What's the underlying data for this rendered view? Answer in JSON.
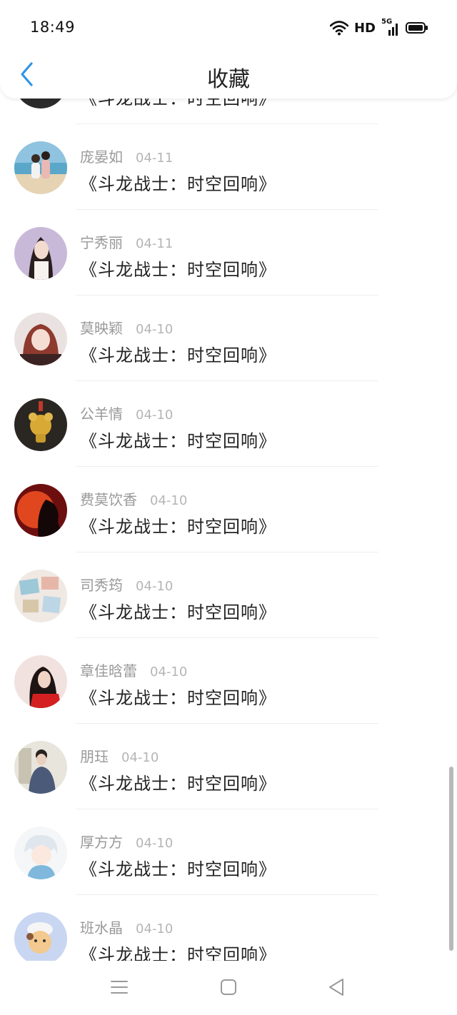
{
  "status_bar": {
    "time": "18:49",
    "network": "HD",
    "signal_label": "5G"
  },
  "header": {
    "title": "收藏",
    "back_icon": "chevron-left-icon",
    "accent": "#2f95e6"
  },
  "items": [
    {
      "name": "",
      "date": "",
      "title": "《斗龙战士：时空回响》",
      "avatar": "dark-avatar"
    },
    {
      "name": "庞晏如",
      "date": "04-11",
      "title": "《斗龙战士：时空回响》",
      "avatar": "beach-couple-photo"
    },
    {
      "name": "宁秀丽",
      "date": "04-11",
      "title": "《斗龙战士：时空回响》",
      "avatar": "woman-portrait"
    },
    {
      "name": "莫映颖",
      "date": "04-10",
      "title": "《斗龙战士：时空回响》",
      "avatar": "girl-portrait"
    },
    {
      "name": "公羊情",
      "date": "04-10",
      "title": "《斗龙战士：时空回响》",
      "avatar": "gold-mouse-pendant"
    },
    {
      "name": "费莫饮香",
      "date": "04-10",
      "title": "《斗龙战士：时空回响》",
      "avatar": "red-silhouette"
    },
    {
      "name": "司秀筠",
      "date": "04-10",
      "title": "《斗龙战士：时空回响》",
      "avatar": "photo-collage"
    },
    {
      "name": "章佳晗蕾",
      "date": "04-10",
      "title": "《斗龙战士：时空回响》",
      "avatar": "red-dress-girl"
    },
    {
      "name": "朋珏",
      "date": "04-10",
      "title": "《斗龙战士：时空回响》",
      "avatar": "man-sweater"
    },
    {
      "name": "厚方方",
      "date": "04-10",
      "title": "《斗龙战士：时空回响》",
      "avatar": "anime-boy"
    },
    {
      "name": "班水晶",
      "date": "04-10",
      "title": "《斗龙战士：时空回响》",
      "avatar": "cartoon-character"
    }
  ],
  "nav_bar": {
    "menu_icon": "menu-icon",
    "home_icon": "home-square-icon",
    "back_icon": "back-triangle-icon"
  }
}
